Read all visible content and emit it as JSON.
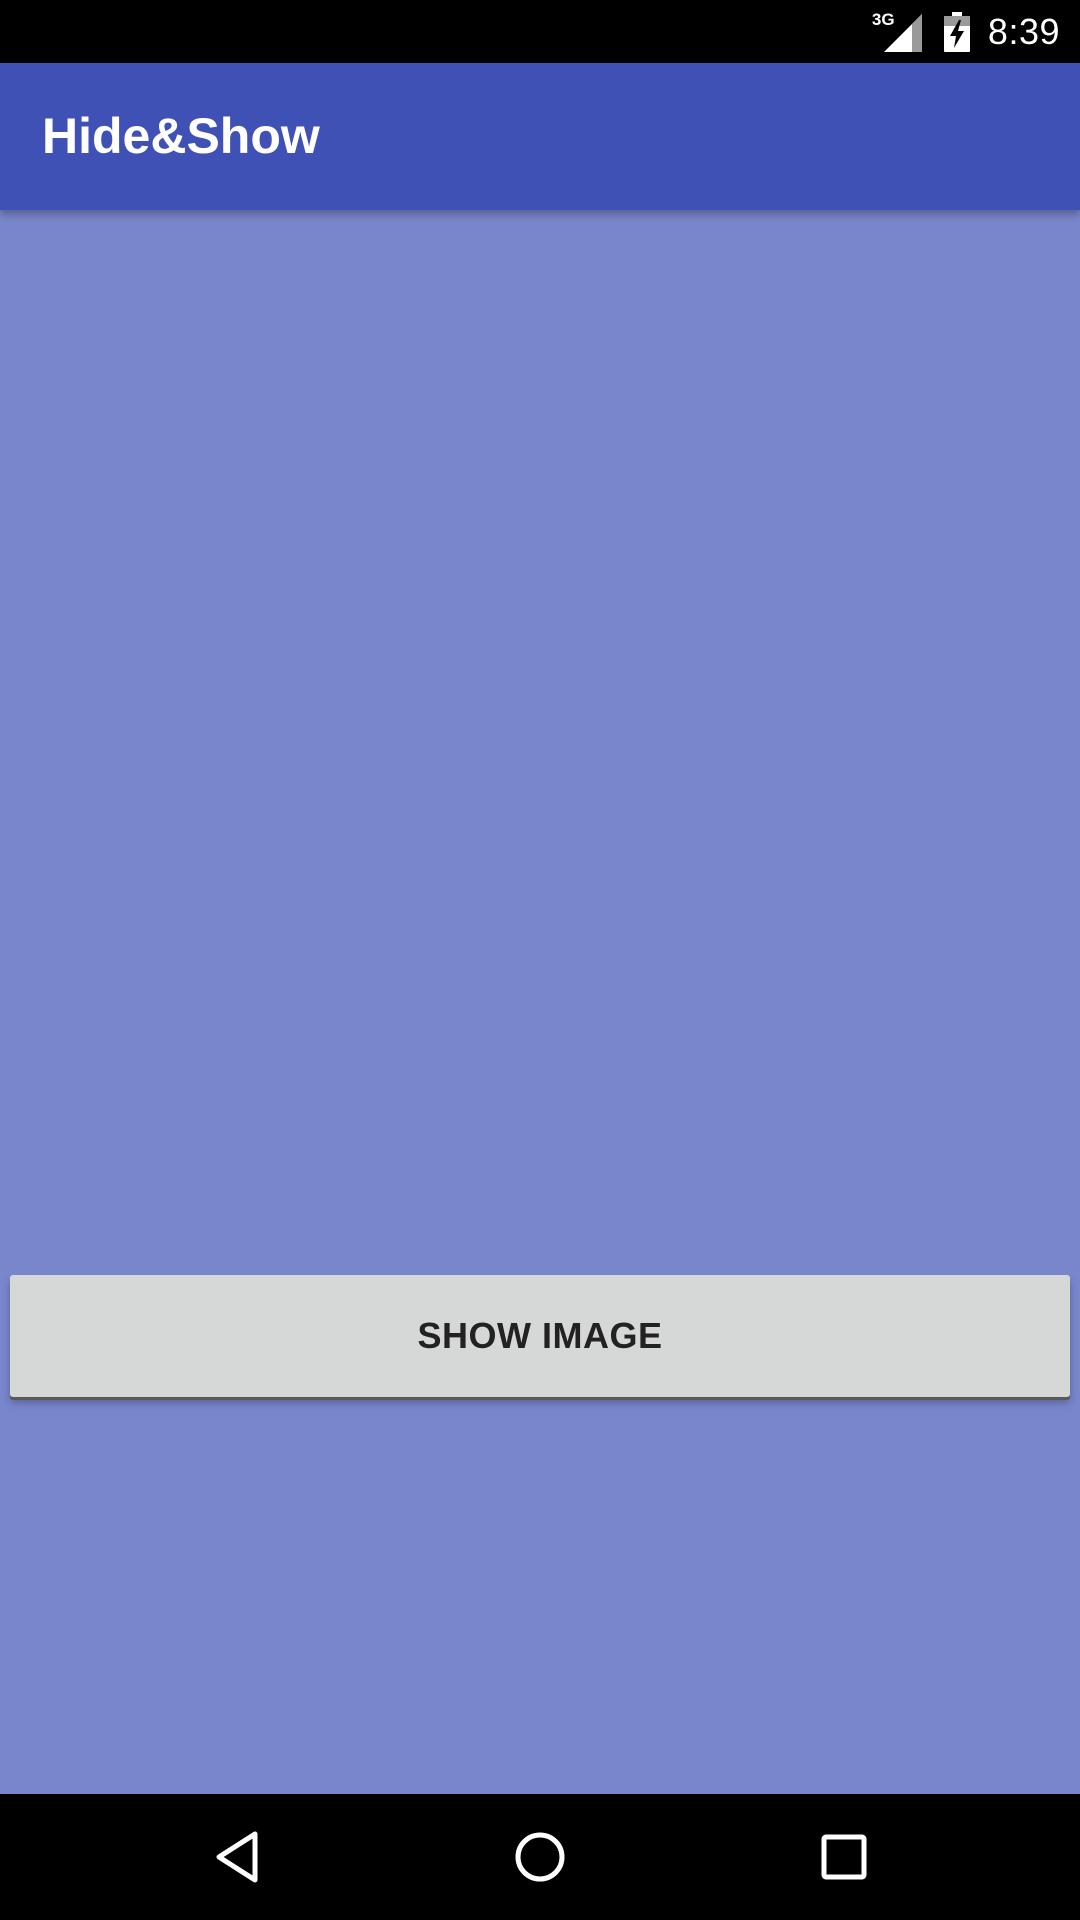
{
  "status_bar": {
    "network_label": "3G",
    "network_icon": "signal-icon",
    "battery_icon": "battery-charging-icon",
    "time": "8:39"
  },
  "app_bar": {
    "title": "Hide&Show",
    "color": "#3f51b5"
  },
  "main": {
    "background_color": "#7986cb",
    "show_image_button": {
      "label": "SHOW IMAGE"
    }
  },
  "nav_bar": {
    "back_icon": "back-icon",
    "home_icon": "home-icon",
    "recents_icon": "recents-icon"
  }
}
